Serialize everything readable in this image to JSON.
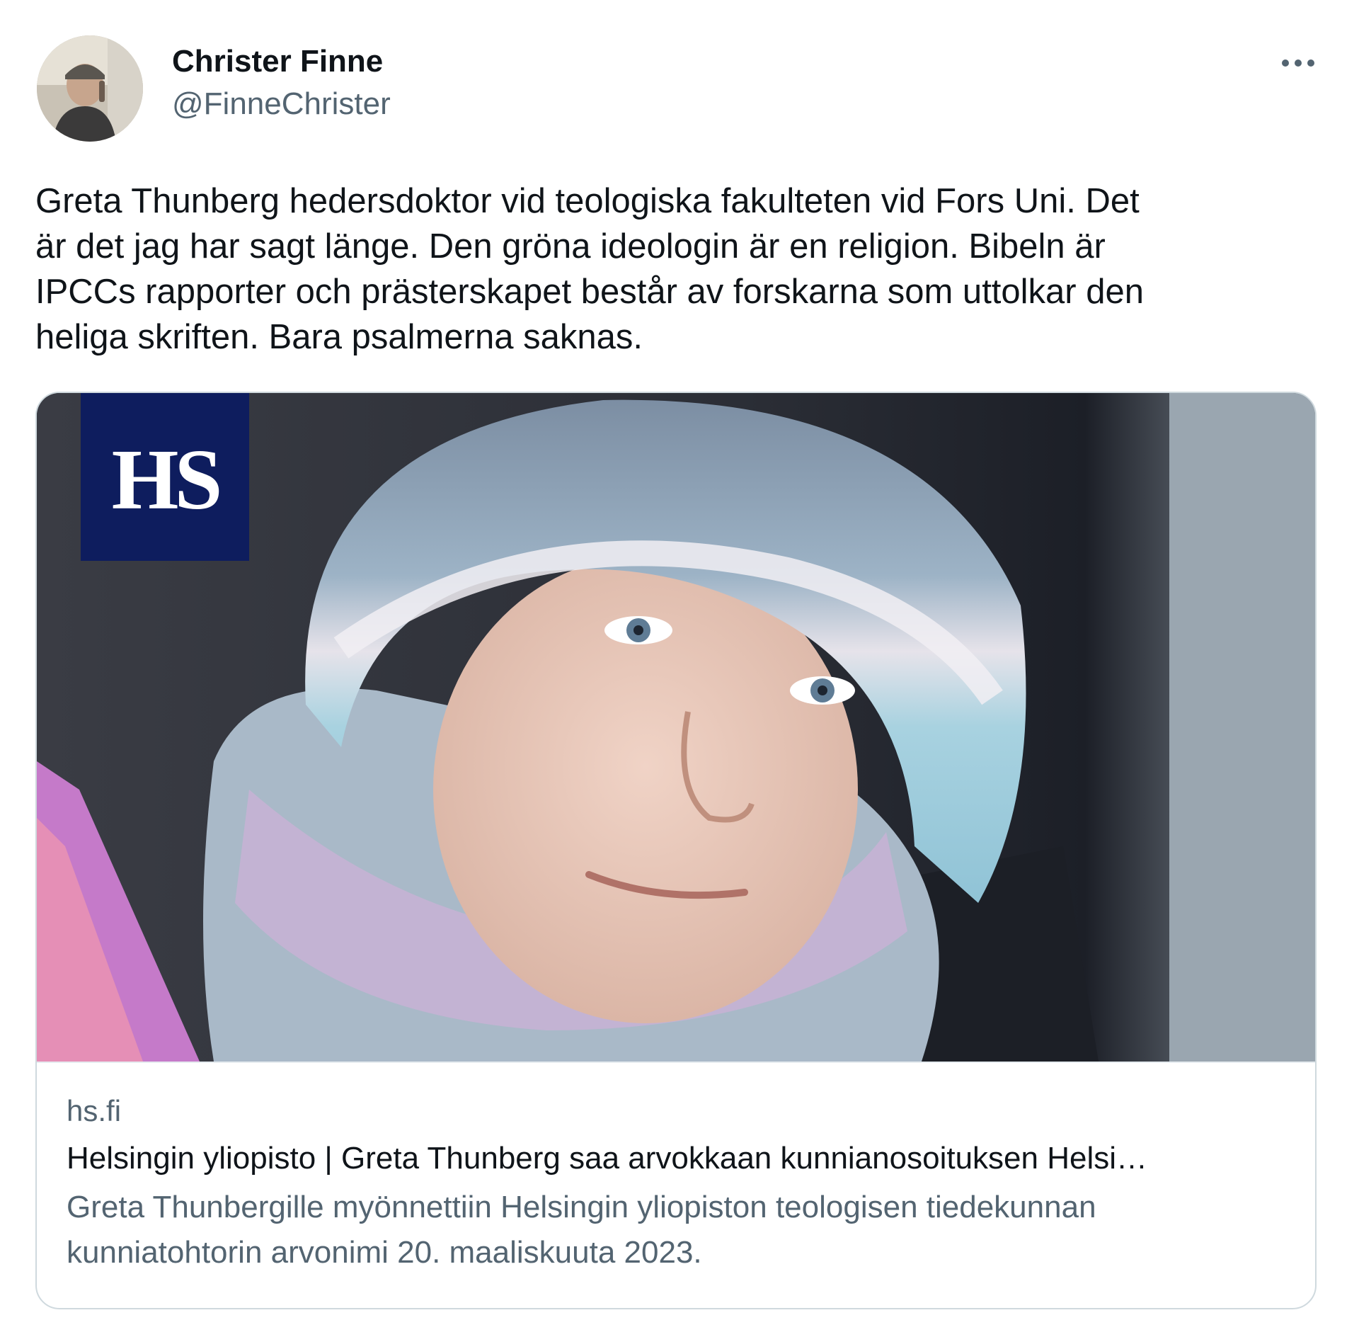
{
  "author": {
    "name": "Christer Finne",
    "handle": "@FinneChrister"
  },
  "icons": {
    "more": "more-horizontal-icon"
  },
  "tweet": {
    "text": "Greta Thunberg hedersdoktor vid teologiska fakulteten vid Fors Uni. Det\när det jag har sagt länge. Den gröna ideologin är en religion. Bibeln är\nIPCCs rapporter och prästerskapet består av forskarna som uttolkar den\nheliga skriften. Bara psalmerna saknas."
  },
  "card": {
    "logo_text": "HS",
    "domain": "hs.fi",
    "title": "Helsingin yliopisto | Greta Thunberg saa arvokkaan kunnianosoituksen Helsi…",
    "description": "Greta Thunbergille myönnettiin Helsingin yliopiston teologisen tiedekunnan kunniatohtorin arvonimi 20. maaliskuuta 2023."
  },
  "colors": {
    "text_primary": "#0f1419",
    "text_secondary": "#536471",
    "card_border": "#cfd9de",
    "hs_brand": "#0e1d5e"
  }
}
